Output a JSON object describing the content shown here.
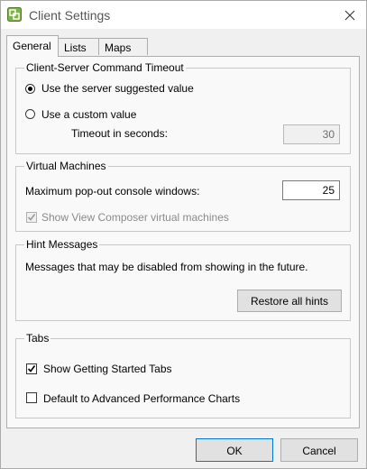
{
  "window": {
    "title": "Client Settings"
  },
  "tabs": [
    {
      "label": "General"
    },
    {
      "label": "Lists"
    },
    {
      "label": "Maps"
    }
  ],
  "timeout_group": {
    "legend": "Client-Server Command Timeout",
    "option_server": "Use the server suggested value",
    "option_custom": "Use a custom value",
    "selected": "server",
    "timeout_label": "Timeout in seconds:",
    "timeout_value": "30"
  },
  "vm_group": {
    "legend": "Virtual Machines",
    "max_popout_label": "Maximum pop-out console windows:",
    "max_popout_value": "25",
    "show_composer_label": "Show View Composer virtual machines",
    "show_composer_checked": true
  },
  "hint_group": {
    "legend": "Hint Messages",
    "description": "Messages that may be disabled from showing in the future.",
    "restore_button": "Restore all hints"
  },
  "tabs_group": {
    "legend": "Tabs",
    "getting_started_label": "Show Getting Started Tabs",
    "getting_started_checked": true,
    "adv_perf_label": "Default to Advanced Performance Charts",
    "adv_perf_checked": false
  },
  "footer": {
    "ok": "OK",
    "cancel": "Cancel"
  },
  "icons": {
    "app": "vsphere-client-icon",
    "close": "close-icon",
    "check": "check-mark-icon"
  }
}
